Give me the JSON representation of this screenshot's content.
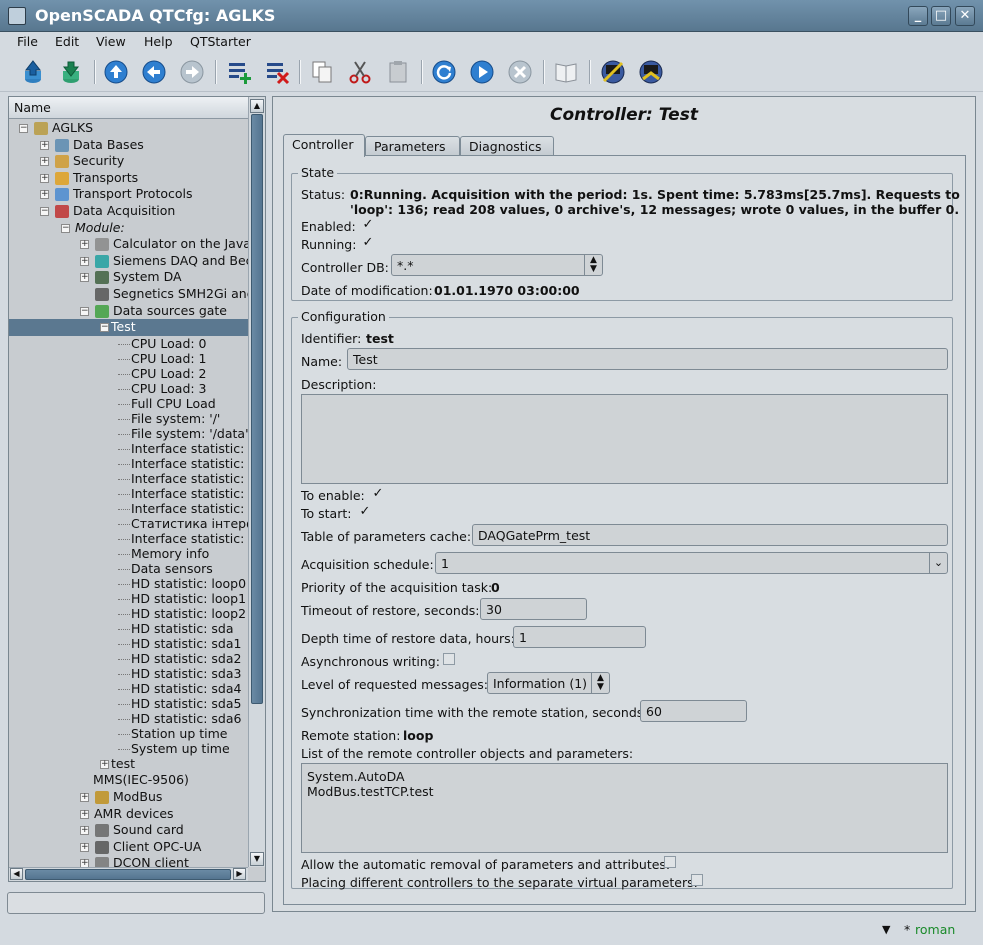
{
  "window": {
    "title": "OpenSCADA QTCfg: AGLKS"
  },
  "menu": [
    "File",
    "Edit",
    "View",
    "Help",
    "QTStarter"
  ],
  "toolbar": [
    {
      "name": "db-load-icon"
    },
    {
      "name": "db-save-icon"
    },
    {
      "name": "up-icon"
    },
    {
      "name": "back-icon"
    },
    {
      "name": "forward-icon"
    },
    {
      "name": "add-item-icon"
    },
    {
      "name": "delete-item-icon"
    },
    {
      "name": "copy-icon"
    },
    {
      "name": "cut-icon"
    },
    {
      "name": "paste-icon"
    },
    {
      "name": "refresh-icon"
    },
    {
      "name": "start-icon"
    },
    {
      "name": "stop-icon"
    },
    {
      "name": "manual-icon"
    },
    {
      "name": "vision-icon"
    },
    {
      "name": "uivision-icon"
    }
  ],
  "tree": {
    "header": "Name",
    "nodes": [
      {
        "label": "AGLKS",
        "level": 0,
        "exp": "−",
        "icon": "station"
      },
      {
        "label": "Data Bases",
        "level": 1,
        "exp": "+",
        "icon": "db"
      },
      {
        "label": "Security",
        "level": 1,
        "exp": "+",
        "icon": "security"
      },
      {
        "label": "Transports",
        "level": 1,
        "exp": "+",
        "icon": "transport"
      },
      {
        "label": "Transport Protocols",
        "level": 1,
        "exp": "+",
        "icon": "protocol"
      },
      {
        "label": "Data Acquisition",
        "level": 1,
        "exp": "−",
        "icon": "daq"
      },
      {
        "label": "Module:",
        "level": 2,
        "exp": "−",
        "icon": "",
        "italic": true
      },
      {
        "label": "Calculator on the Java-",
        "level": 3,
        "exp": "+",
        "icon": "calc"
      },
      {
        "label": "Siemens DAQ and Bec",
        "level": 3,
        "exp": "+",
        "icon": "siemens"
      },
      {
        "label": "System DA",
        "level": 3,
        "exp": "+",
        "icon": "sysda"
      },
      {
        "label": "Segnetics SMH2Gi and",
        "level": 3,
        "exp": "",
        "icon": "segnetics"
      },
      {
        "label": "Data sources gate",
        "level": 3,
        "exp": "−",
        "icon": "gate"
      },
      {
        "label": "Test",
        "level": 4,
        "exp": "−",
        "icon": "",
        "selected": true
      },
      {
        "label": "CPU Load: 0",
        "level": 5
      },
      {
        "label": "CPU Load: 1",
        "level": 5
      },
      {
        "label": "CPU Load: 2",
        "level": 5
      },
      {
        "label": "CPU Load: 3",
        "level": 5
      },
      {
        "label": "Full CPU Load",
        "level": 5
      },
      {
        "label": "File system: '/'",
        "level": 5
      },
      {
        "label": "File system: '/data'",
        "level": 5
      },
      {
        "label": "Interface statistic: e",
        "level": 5
      },
      {
        "label": "Interface statistic: e",
        "level": 5
      },
      {
        "label": "Interface statistic: l",
        "level": 5
      },
      {
        "label": "Interface statistic: v",
        "level": 5
      },
      {
        "label": "Interface statistic: v",
        "level": 5
      },
      {
        "label": "Статистика інтерф",
        "level": 5
      },
      {
        "label": "Interface statistic: v",
        "level": 5
      },
      {
        "label": "Memory info",
        "level": 5
      },
      {
        "label": "Data sensors",
        "level": 5
      },
      {
        "label": "HD statistic: loop0",
        "level": 5
      },
      {
        "label": "HD statistic: loop1",
        "level": 5
      },
      {
        "label": "HD statistic: loop2",
        "level": 5
      },
      {
        "label": "HD statistic: sda",
        "level": 5
      },
      {
        "label": "HD statistic: sda1",
        "level": 5
      },
      {
        "label": "HD statistic: sda2",
        "level": 5
      },
      {
        "label": "HD statistic: sda3",
        "level": 5
      },
      {
        "label": "HD statistic: sda4",
        "level": 5
      },
      {
        "label": "HD statistic: sda5",
        "level": 5
      },
      {
        "label": "HD statistic: sda6",
        "level": 5
      },
      {
        "label": "Station up time",
        "level": 5
      },
      {
        "label": "System up time",
        "level": 5
      },
      {
        "label": "test",
        "level": 4,
        "exp": "+",
        "icon": ""
      },
      {
        "label": "MMS(IEC-9506)",
        "level": 3,
        "exp": "",
        "icon": ""
      },
      {
        "label": "ModBus",
        "level": 3,
        "exp": "+",
        "icon": "modbus"
      },
      {
        "label": "AMR devices",
        "level": 3,
        "exp": "+",
        "icon": ""
      },
      {
        "label": "Sound card",
        "level": 3,
        "exp": "+",
        "icon": "sound"
      },
      {
        "label": "Client OPC-UA",
        "level": 3,
        "exp": "+",
        "icon": "opcua"
      },
      {
        "label": "DCON client",
        "level": 3,
        "exp": "+",
        "icon": "dcon"
      }
    ]
  },
  "content": {
    "title": "Controller: Test",
    "tabs": [
      "Controller",
      "Parameters",
      "Diagnostics"
    ],
    "state": {
      "legend": "State",
      "status_label": "Status:",
      "status_line1": "0:Running. Acquisition with the period: 1s. Spent time: 5.783ms[25.7ms]. Requests to",
      "status_line2": "'loop': 136; read 208 values, 0 archive's, 12 messages; wrote 0 values, in the buffer 0.",
      "enabled_label": "Enabled:",
      "enabled": true,
      "running_label": "Running:",
      "running": true,
      "db_label": "Controller DB:",
      "db_value": "*.*",
      "date_label": "Date of modification:",
      "date_value": "01.01.1970 03:00:00"
    },
    "config": {
      "legend": "Configuration",
      "id_label": "Identifier:",
      "id_value": "test",
      "name_label": "Name:",
      "name_value": "Test",
      "descr_label": "Description:",
      "descr_value": "",
      "toenable_label": "To enable:",
      "toenable": true,
      "tostart_label": "To start:",
      "tostart": true,
      "cache_label": "Table of parameters cache:",
      "cache_value": "DAQGatePrm_test",
      "schedule_label": "Acquisition schedule:",
      "schedule_value": "1",
      "priority_label": "Priority of the acquisition task:",
      "priority_value": "0",
      "timeout_label": "Timeout of restore, seconds:",
      "timeout_value": "30",
      "depth_label": "Depth time of restore data, hours:",
      "depth_value": "1",
      "async_label": "Asynchronous writing:",
      "async": false,
      "level_label": "Level of requested messages:",
      "level_value": "Information (1)",
      "sync_label": "Synchronization time with the remote station, seconds:",
      "sync_value": "60",
      "remote_label": "Remote station:",
      "remote_value": "loop",
      "list_label": "List of the remote controller objects and parameters:",
      "list_line1": "System.AutoDA",
      "list_line2": "ModBus.testTCP.test",
      "autoremove_label": "Allow the automatic removal of parameters and attributes:",
      "autoremove": false,
      "separate_label": "Placing different controllers to the separate virtual parameters:",
      "separate": false
    }
  },
  "statusbar": {
    "user": "roman",
    "marker": "*"
  }
}
